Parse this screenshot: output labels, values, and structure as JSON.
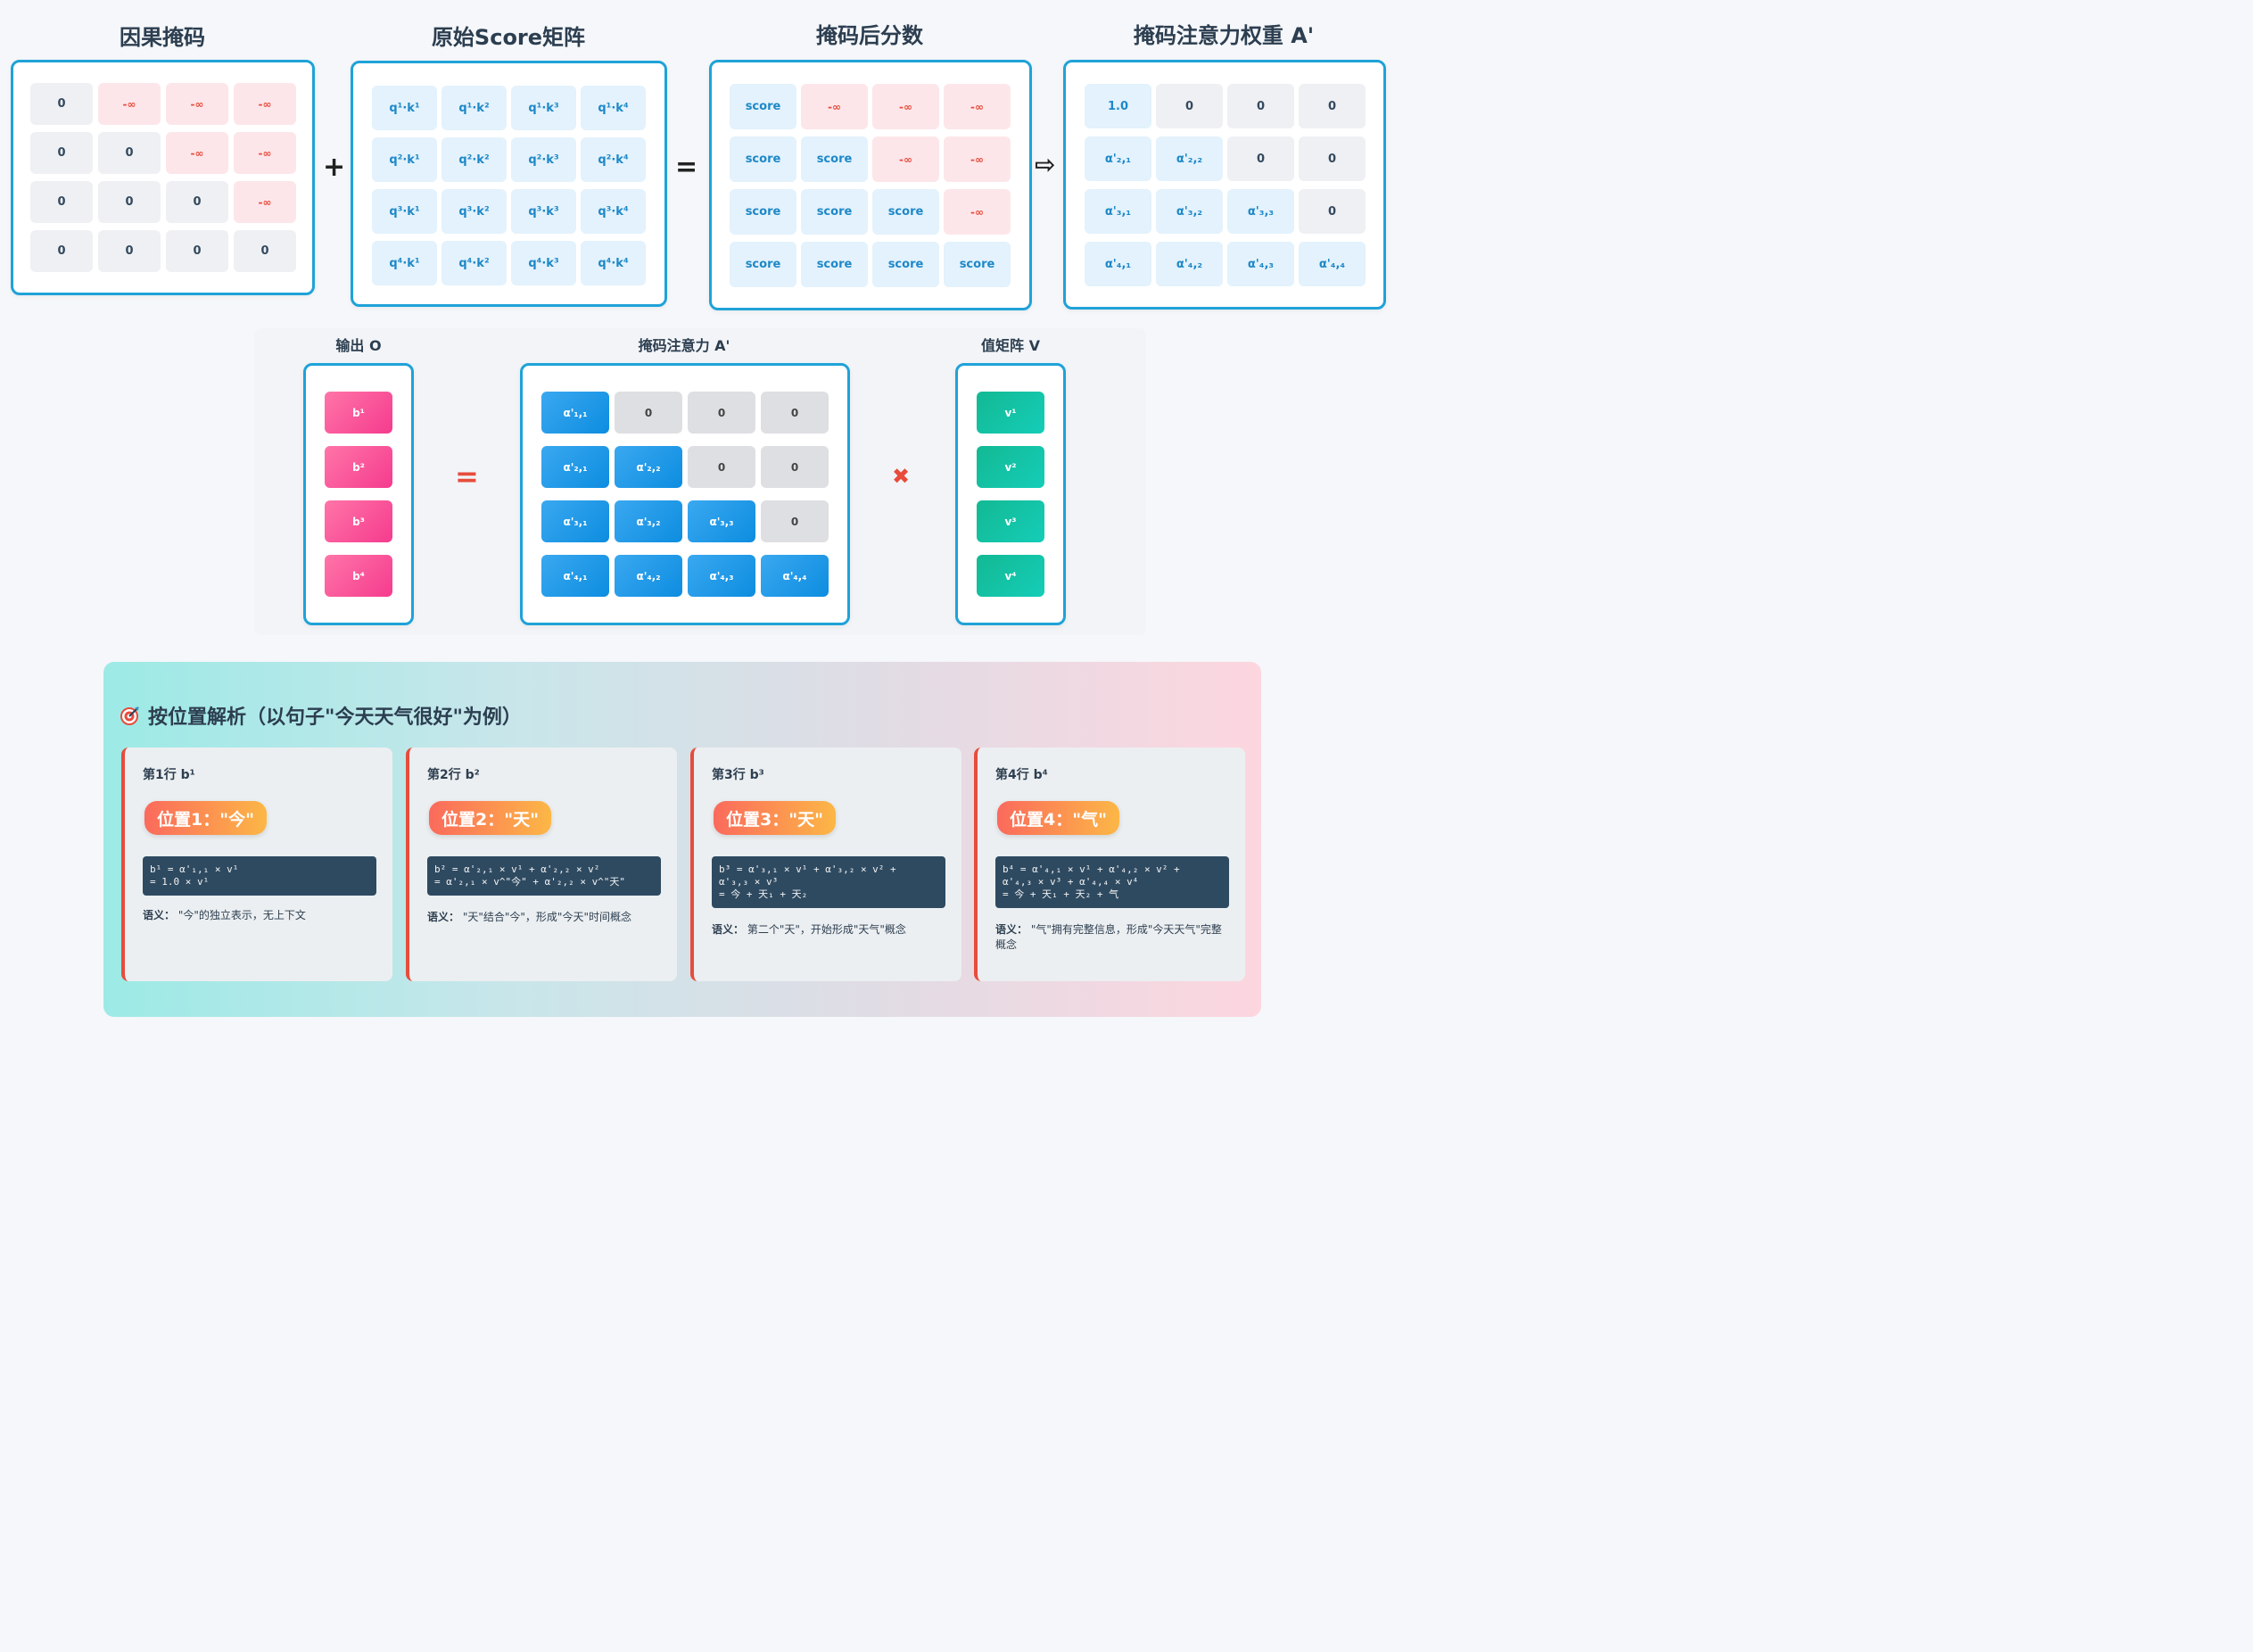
{
  "top": {
    "titles": [
      "因果掩码",
      "原始Score矩阵",
      "掩码后分数",
      "掩码注意力权重 A'"
    ],
    "plus": "+",
    "equals": "=",
    "arrow": "⇨",
    "mask": [
      [
        "0",
        "-∞",
        "-∞",
        "-∞"
      ],
      [
        "0",
        "0",
        "-∞",
        "-∞"
      ],
      [
        "0",
        "0",
        "0",
        "-∞"
      ],
      [
        "0",
        "0",
        "0",
        "0"
      ]
    ],
    "score": [
      [
        "q¹·k¹",
        "q¹·k²",
        "q¹·k³",
        "q¹·k⁴"
      ],
      [
        "q²·k¹",
        "q²·k²",
        "q²·k³",
        "q²·k⁴"
      ],
      [
        "q³·k¹",
        "q³·k²",
        "q³·k³",
        "q³·k⁴"
      ],
      [
        "q⁴·k¹",
        "q⁴·k²",
        "q⁴·k³",
        "q⁴·k⁴"
      ]
    ],
    "masked": [
      [
        "score",
        "-∞",
        "-∞",
        "-∞"
      ],
      [
        "score",
        "score",
        "-∞",
        "-∞"
      ],
      [
        "score",
        "score",
        "score",
        "-∞"
      ],
      [
        "score",
        "score",
        "score",
        "score"
      ]
    ],
    "weights": [
      [
        "1.0",
        "0",
        "0",
        "0"
      ],
      [
        "α'₂,₁",
        "α'₂,₂",
        "0",
        "0"
      ],
      [
        "α'₃,₁",
        "α'₃,₂",
        "α'₃,₃",
        "0"
      ],
      [
        "α'₄,₁",
        "α'₄,₂",
        "α'₄,₃",
        "α'₄,₄"
      ]
    ]
  },
  "middle": {
    "output_title": "输出 O",
    "attn_title": "掩码注意力 A'",
    "value_title": "值矩阵 V",
    "equals": "=",
    "times": "✖",
    "outputs": [
      "b¹",
      "b²",
      "b³",
      "b⁴"
    ],
    "values": [
      "v¹",
      "v²",
      "v³",
      "v⁴"
    ],
    "attn": [
      [
        "α'₁,₁",
        "0",
        "0",
        "0"
      ],
      [
        "α'₂,₁",
        "α'₂,₂",
        "0",
        "0"
      ],
      [
        "α'₃,₁",
        "α'₃,₂",
        "α'₃,₃",
        "0"
      ],
      [
        "α'₄,₁",
        "α'₄,₂",
        "α'₄,₃",
        "α'₄,₄"
      ]
    ]
  },
  "analysis": {
    "icon": "target-icon",
    "title": "按位置解析（以句子\"今天天气很好\"为例）",
    "sem_label": "语义：",
    "cards": [
      {
        "row": "第1行 b¹",
        "pill": "位置1：\"今\"",
        "code": "b¹ = α'₁,₁ × v¹\n= 1.0 × v¹",
        "semantic": "\"今\"的独立表示，无上下文"
      },
      {
        "row": "第2行 b²",
        "pill": "位置2：\"天\"",
        "code": "b² = α'₂,₁ × v¹ + α'₂,₂ × v²\n= α'₂,₁ × v^\"今\" + α'₂,₂ × v^\"天\"",
        "semantic": "\"天\"结合\"今\"，形成\"今天\"时间概念"
      },
      {
        "row": "第3行 b³",
        "pill": "位置3：\"天\"",
        "code": "b³ = α'₃,₁ × v¹ + α'₃,₂ × v² +\nα'₃,₃ × v³\n= 今 + 天₁ + 天₂",
        "semantic": "第二个\"天\"，开始形成\"天气\"概念"
      },
      {
        "row": "第4行 b⁴",
        "pill": "位置4：\"气\"",
        "code": "b⁴ = α'₄,₁ × v¹ + α'₄,₂ × v² +\nα'₄,₃ × v³ + α'₄,₄ × v⁴\n= 今 + 天₁ + 天₂ + 气",
        "semantic": "\"气\"拥有完整信息，形成\"今天天气\"完整概念"
      }
    ]
  }
}
